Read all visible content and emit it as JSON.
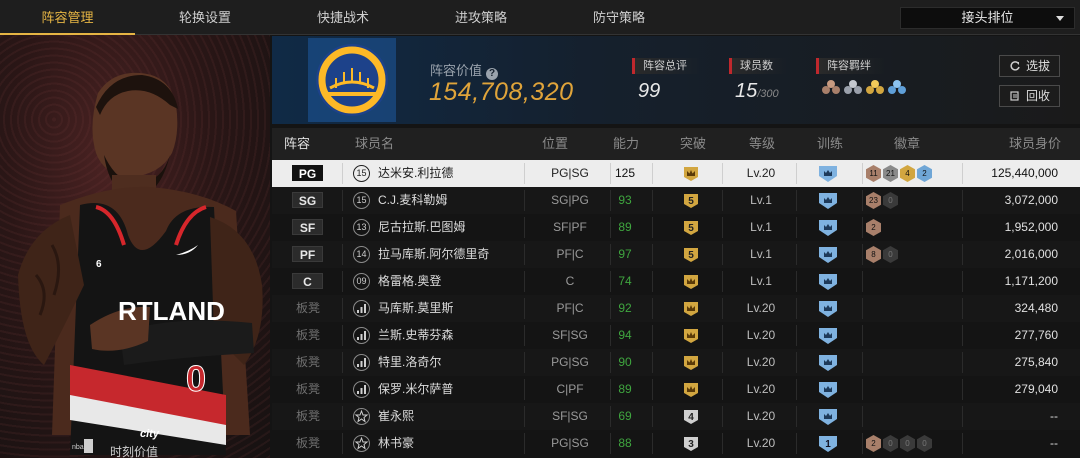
{
  "tabs": [
    {
      "label": "阵容管理",
      "active": true
    },
    {
      "label": "轮换设置",
      "active": false
    },
    {
      "label": "快捷战术",
      "active": false
    },
    {
      "label": "进攻策略",
      "active": false
    },
    {
      "label": "防守策略",
      "active": false
    }
  ],
  "dropdown": {
    "selected": "接头排位"
  },
  "hero": {
    "moment_label": "时刻价值",
    "jersey_text": "RTLAND",
    "jersey_number": "0",
    "jersey_small_number": "6",
    "logo_text": "nba",
    "jersey_brand": "city"
  },
  "summary": {
    "value_label": "阵容价值",
    "value": "154,708,320",
    "rating_label": "阵容总评",
    "rating": "99",
    "players_label": "球员数",
    "players": "15",
    "players_max": "/300",
    "bonds_label": "阵容羁绊",
    "btn_select": "选拔",
    "btn_recycle": "回收"
  },
  "columns": [
    "阵容",
    "球员名",
    "位置",
    "能力",
    "突破",
    "等级",
    "训练",
    "徽章",
    "球员身价"
  ],
  "colors": {
    "accent": "#e6b544",
    "green": "#3fa63f",
    "value_gold": "#e0a43a",
    "badge_bronze": "#a87f6a",
    "badge_silver": "#8a8a8a",
    "badge_gold": "#d2a640",
    "badge_blue": "#6fa6d6",
    "train_blue": "#7fb2e0"
  },
  "rows": [
    {
      "slot": "PG",
      "starter": true,
      "selected": true,
      "icon": "jersey",
      "num": "15",
      "name": "达米安.利拉德",
      "pos": "PG|SG",
      "ability": "125",
      "ability_green": false,
      "breakthrough": "crown",
      "level": "Lv.20",
      "train": "",
      "badges": [
        {
          "t": "bronze",
          "v": "11"
        },
        {
          "t": "silver",
          "v": "21"
        },
        {
          "t": "gold",
          "v": "4"
        },
        {
          "t": "blue",
          "v": "2"
        }
      ],
      "worth": "125,440,000"
    },
    {
      "slot": "SG",
      "starter": true,
      "icon": "jersey",
      "num": "15",
      "name": "C.J.麦科勒姆",
      "pos": "SG|PG",
      "ability": "93",
      "ability_green": true,
      "breakthrough": "5",
      "level": "Lv.1",
      "train": "",
      "badges": [
        {
          "t": "bronze",
          "v": "23"
        },
        {
          "t": "dark",
          "v": "0"
        }
      ],
      "worth": "3,072,000"
    },
    {
      "slot": "SF",
      "starter": true,
      "icon": "jersey",
      "num": "13",
      "name": "尼古拉斯.巴图姆",
      "pos": "SF|PF",
      "ability": "89",
      "ability_green": true,
      "breakthrough": "5",
      "level": "Lv.1",
      "train": "",
      "badges": [
        {
          "t": "bronze",
          "v": "2"
        }
      ],
      "worth": "1,952,000"
    },
    {
      "slot": "PF",
      "starter": true,
      "icon": "jersey",
      "num": "14",
      "name": "拉马库斯.阿尔德里奇",
      "pos": "PF|C",
      "ability": "97",
      "ability_green": true,
      "breakthrough": "5",
      "level": "Lv.1",
      "train": "",
      "badges": [
        {
          "t": "bronze",
          "v": "8"
        },
        {
          "t": "dark",
          "v": "0"
        }
      ],
      "worth": "2,016,000"
    },
    {
      "slot": "C",
      "starter": true,
      "icon": "jersey",
      "num": "09",
      "name": "格雷格.奥登",
      "pos": "C",
      "ability": "74",
      "ability_green": true,
      "breakthrough": "crown",
      "level": "Lv.1",
      "train": "",
      "badges": [],
      "worth": "1,171,200"
    },
    {
      "slot": "板凳",
      "starter": false,
      "icon": "bars",
      "num": "",
      "name": "马库斯.莫里斯",
      "pos": "PF|C",
      "ability": "92",
      "ability_green": true,
      "breakthrough": "crown",
      "level": "Lv.20",
      "train": "",
      "badges": [],
      "worth": "324,480"
    },
    {
      "slot": "板凳",
      "starter": false,
      "icon": "bars",
      "num": "",
      "name": "兰斯.史蒂芬森",
      "pos": "SF|SG",
      "ability": "94",
      "ability_green": true,
      "breakthrough": "crown",
      "level": "Lv.20",
      "train": "",
      "badges": [],
      "worth": "277,760"
    },
    {
      "slot": "板凳",
      "starter": false,
      "icon": "bars",
      "num": "",
      "name": "特里.洛奇尔",
      "pos": "PG|SG",
      "ability": "90",
      "ability_green": true,
      "breakthrough": "crown",
      "level": "Lv.20",
      "train": "",
      "badges": [],
      "worth": "275,840"
    },
    {
      "slot": "板凳",
      "starter": false,
      "icon": "bars",
      "num": "",
      "name": "保罗.米尔萨普",
      "pos": "C|PF",
      "ability": "89",
      "ability_green": true,
      "breakthrough": "crown",
      "level": "Lv.20",
      "train": "",
      "badges": [],
      "worth": "279,040"
    },
    {
      "slot": "板凳",
      "starter": false,
      "icon": "star",
      "num": "",
      "name": "崔永熙",
      "pos": "SF|SG",
      "ability": "69",
      "ability_green": true,
      "breakthrough": "4",
      "level": "Lv.20",
      "train": "",
      "badges": [],
      "worth": "--"
    },
    {
      "slot": "板凳",
      "starter": false,
      "icon": "star",
      "num": "",
      "name": "林书豪",
      "pos": "PG|SG",
      "ability": "88",
      "ability_green": true,
      "breakthrough": "3",
      "level": "Lv.20",
      "train": "1",
      "badges": [
        {
          "t": "bronze",
          "v": "2"
        },
        {
          "t": "dark",
          "v": "0"
        },
        {
          "t": "dark",
          "v": "0"
        },
        {
          "t": "dark",
          "v": "0"
        }
      ],
      "worth": "--"
    }
  ]
}
